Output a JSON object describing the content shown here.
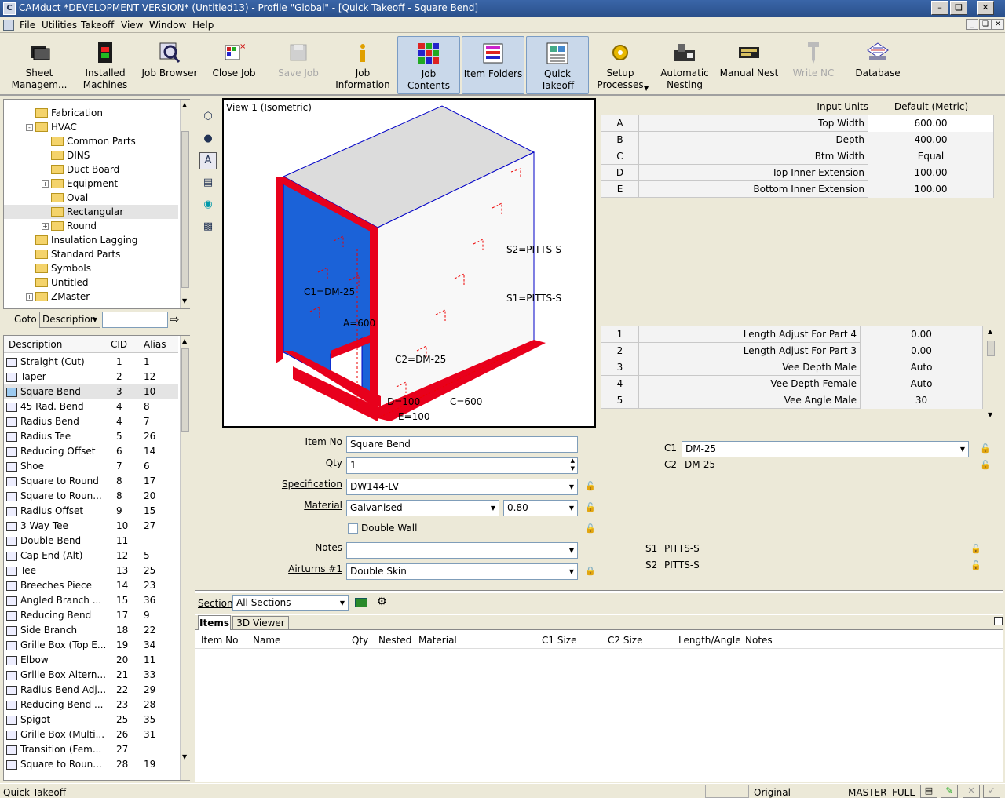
{
  "window": {
    "title": "CAMduct *DEVELOPMENT VERSION* (Untitled13) - Profile \"Global\" - [Quick Takeoff - Square Bend]"
  },
  "menu": [
    "File",
    "Utilities",
    "Takeoff",
    "View",
    "Window",
    "Help"
  ],
  "toolbar": [
    {
      "label": "Sheet\nManagem...",
      "icon": "sheet-manager-icon",
      "state": "normal"
    },
    {
      "label": "Installed\nMachines",
      "icon": "machine-icon",
      "state": "normal"
    },
    {
      "label": "Job Browser",
      "icon": "job-browser-icon",
      "state": "normal"
    },
    {
      "label": "Close Job",
      "icon": "close-job-icon",
      "state": "normal"
    },
    {
      "label": "Save Job",
      "icon": "save-job-icon",
      "state": "disabled"
    },
    {
      "label": "Job\nInformation",
      "icon": "info-icon",
      "state": "normal"
    },
    {
      "label": "Job\nContents",
      "icon": "job-contents-icon",
      "state": "active"
    },
    {
      "label": "Item Folders",
      "icon": "item-folders-icon",
      "state": "active"
    },
    {
      "label": "Quick\nTakeoff",
      "icon": "quick-takeoff-icon",
      "state": "active"
    },
    {
      "label": "Setup\nProcesses",
      "icon": "setup-processes-icon",
      "state": "normal"
    },
    {
      "label": "Automatic\nNesting",
      "icon": "automatic-nesting-icon",
      "state": "normal"
    },
    {
      "label": "Manual Nest",
      "icon": "manual-nest-icon",
      "state": "normal"
    },
    {
      "label": "Write NC",
      "icon": "write-nc-icon",
      "state": "disabled"
    },
    {
      "label": "Database",
      "icon": "database-icon",
      "state": "normal"
    }
  ],
  "tree": [
    {
      "label": "Fabrication",
      "level": 1,
      "expander": ""
    },
    {
      "label": "HVAC",
      "level": 1,
      "expander": "-"
    },
    {
      "label": "Common Parts",
      "level": 2,
      "expander": ""
    },
    {
      "label": "DINS",
      "level": 2,
      "expander": ""
    },
    {
      "label": "Duct Board",
      "level": 2,
      "expander": ""
    },
    {
      "label": "Equipment",
      "level": 2,
      "expander": "+"
    },
    {
      "label": "Oval",
      "level": 2,
      "expander": ""
    },
    {
      "label": "Rectangular",
      "level": 2,
      "expander": "",
      "selected": true
    },
    {
      "label": "Round",
      "level": 2,
      "expander": "+"
    },
    {
      "label": "Insulation Lagging",
      "level": 1,
      "expander": ""
    },
    {
      "label": "Standard Parts",
      "level": 1,
      "expander": ""
    },
    {
      "label": "Symbols",
      "level": 1,
      "expander": ""
    },
    {
      "label": "Untitled",
      "level": 1,
      "expander": ""
    },
    {
      "label": "ZMaster",
      "level": 1,
      "expander": "+"
    }
  ],
  "goto": {
    "label": "Goto",
    "select": "Description"
  },
  "parts_list": {
    "headers": [
      "Description",
      "CID",
      "Alias"
    ],
    "rows": [
      [
        "Straight (Cut)",
        "1",
        "1"
      ],
      [
        "Taper",
        "2",
        "12"
      ],
      [
        "Square Bend",
        "3",
        "10"
      ],
      [
        "45 Rad. Bend",
        "4",
        "8"
      ],
      [
        "Radius Bend",
        "4",
        "7"
      ],
      [
        "Radius Tee",
        "5",
        "26"
      ],
      [
        "Reducing Offset",
        "6",
        "14"
      ],
      [
        "Shoe",
        "7",
        "6"
      ],
      [
        "Square to Round",
        "8",
        "17"
      ],
      [
        "Square to Roun...",
        "8",
        "20"
      ],
      [
        "Radius Offset",
        "9",
        "15"
      ],
      [
        "3 Way Tee",
        "10",
        "27"
      ],
      [
        "Double Bend",
        "11",
        ""
      ],
      [
        "Cap End (Alt)",
        "12",
        "5"
      ],
      [
        "Tee",
        "13",
        "25"
      ],
      [
        "Breeches Piece",
        "14",
        "23"
      ],
      [
        "Angled Branch ...",
        "15",
        "36"
      ],
      [
        "Reducing Bend",
        "17",
        "9"
      ],
      [
        "Side Branch",
        "18",
        "22"
      ],
      [
        "Grille Box (Top E...",
        "19",
        "34"
      ],
      [
        "Elbow",
        "20",
        "11"
      ],
      [
        "Grille Box Altern...",
        "21",
        "33"
      ],
      [
        "Radius Bend Adj...",
        "22",
        "29"
      ],
      [
        "Reducing Bend ...",
        "23",
        "28"
      ],
      [
        "Spigot",
        "25",
        "35"
      ],
      [
        "Grille Box (Multi...",
        "26",
        "31"
      ],
      [
        "Transition (Fem...",
        "27",
        ""
      ],
      [
        "Square to Roun...",
        "28",
        "19"
      ]
    ],
    "selected_index": 2
  },
  "viewer": {
    "title": "View 1 (Isometric)",
    "labels": [
      "S2=PITTS-S",
      "S1=PITTS-S",
      "C1=DM-25",
      "A=600",
      "C2=DM-25",
      "D=100",
      "E=100",
      "C=600"
    ]
  },
  "dimensions": {
    "header_label": "Input Units",
    "header_value": "Default (Metric)",
    "rows": [
      {
        "key": "A",
        "name": "Top Width",
        "value": "600.00"
      },
      {
        "key": "B",
        "name": "Depth",
        "value": "400.00"
      },
      {
        "key": "C",
        "name": "Btm Width",
        "value": "Equal"
      },
      {
        "key": "D",
        "name": "Top Inner Extension",
        "value": "100.00"
      },
      {
        "key": "E",
        "name": "Bottom Inner Extension",
        "value": "100.00"
      }
    ]
  },
  "options": [
    {
      "key": "1",
      "name": "Length Adjust For Part 4",
      "value": "0.00"
    },
    {
      "key": "2",
      "name": "Length Adjust For Part 3",
      "value": "0.00"
    },
    {
      "key": "3",
      "name": "Vee Depth Male",
      "value": "Auto"
    },
    {
      "key": "4",
      "name": "Vee Depth Female",
      "value": "Auto"
    },
    {
      "key": "5",
      "name": "Vee Angle Male",
      "value": "30"
    }
  ],
  "connectors": [
    {
      "key": "C1",
      "value": "DM-25"
    },
    {
      "key": "C2",
      "value": "DM-25"
    }
  ],
  "seams": [
    {
      "key": "S1",
      "value": "PITTS-S"
    },
    {
      "key": "S2",
      "value": "PITTS-S"
    }
  ],
  "item_form": {
    "item_no_label": "Item No",
    "item_no": "Square Bend",
    "qty_label": "Qty",
    "qty": "1",
    "spec_label": "Specification",
    "spec": "DW144-LV",
    "material_label": "Material",
    "material": "Galvanised",
    "gauge": "0.80",
    "double_wall_label": "Double Wall",
    "notes_label": "Notes",
    "notes": "",
    "airturns_label": "Airturns #1",
    "airturns": "Double Skin"
  },
  "section": {
    "label": "Section",
    "value": "All Sections"
  },
  "tabs": [
    "Items",
    "3D Viewer"
  ],
  "items_table": {
    "headers": [
      "Item No",
      "Name",
      "Qty",
      "Nested",
      "Material",
      "C1 Size",
      "C2 Size",
      "Length/Angle",
      "Notes"
    ]
  },
  "status": {
    "left": "Quick Takeoff",
    "mid": "Original",
    "master": "MASTER",
    "full": "FULL"
  },
  "colors": {
    "titlebar": "#2a4f8a",
    "flange_red": "#e8001c",
    "face_blue": "#1b62d8",
    "top_gray": "#dcdcdc"
  }
}
